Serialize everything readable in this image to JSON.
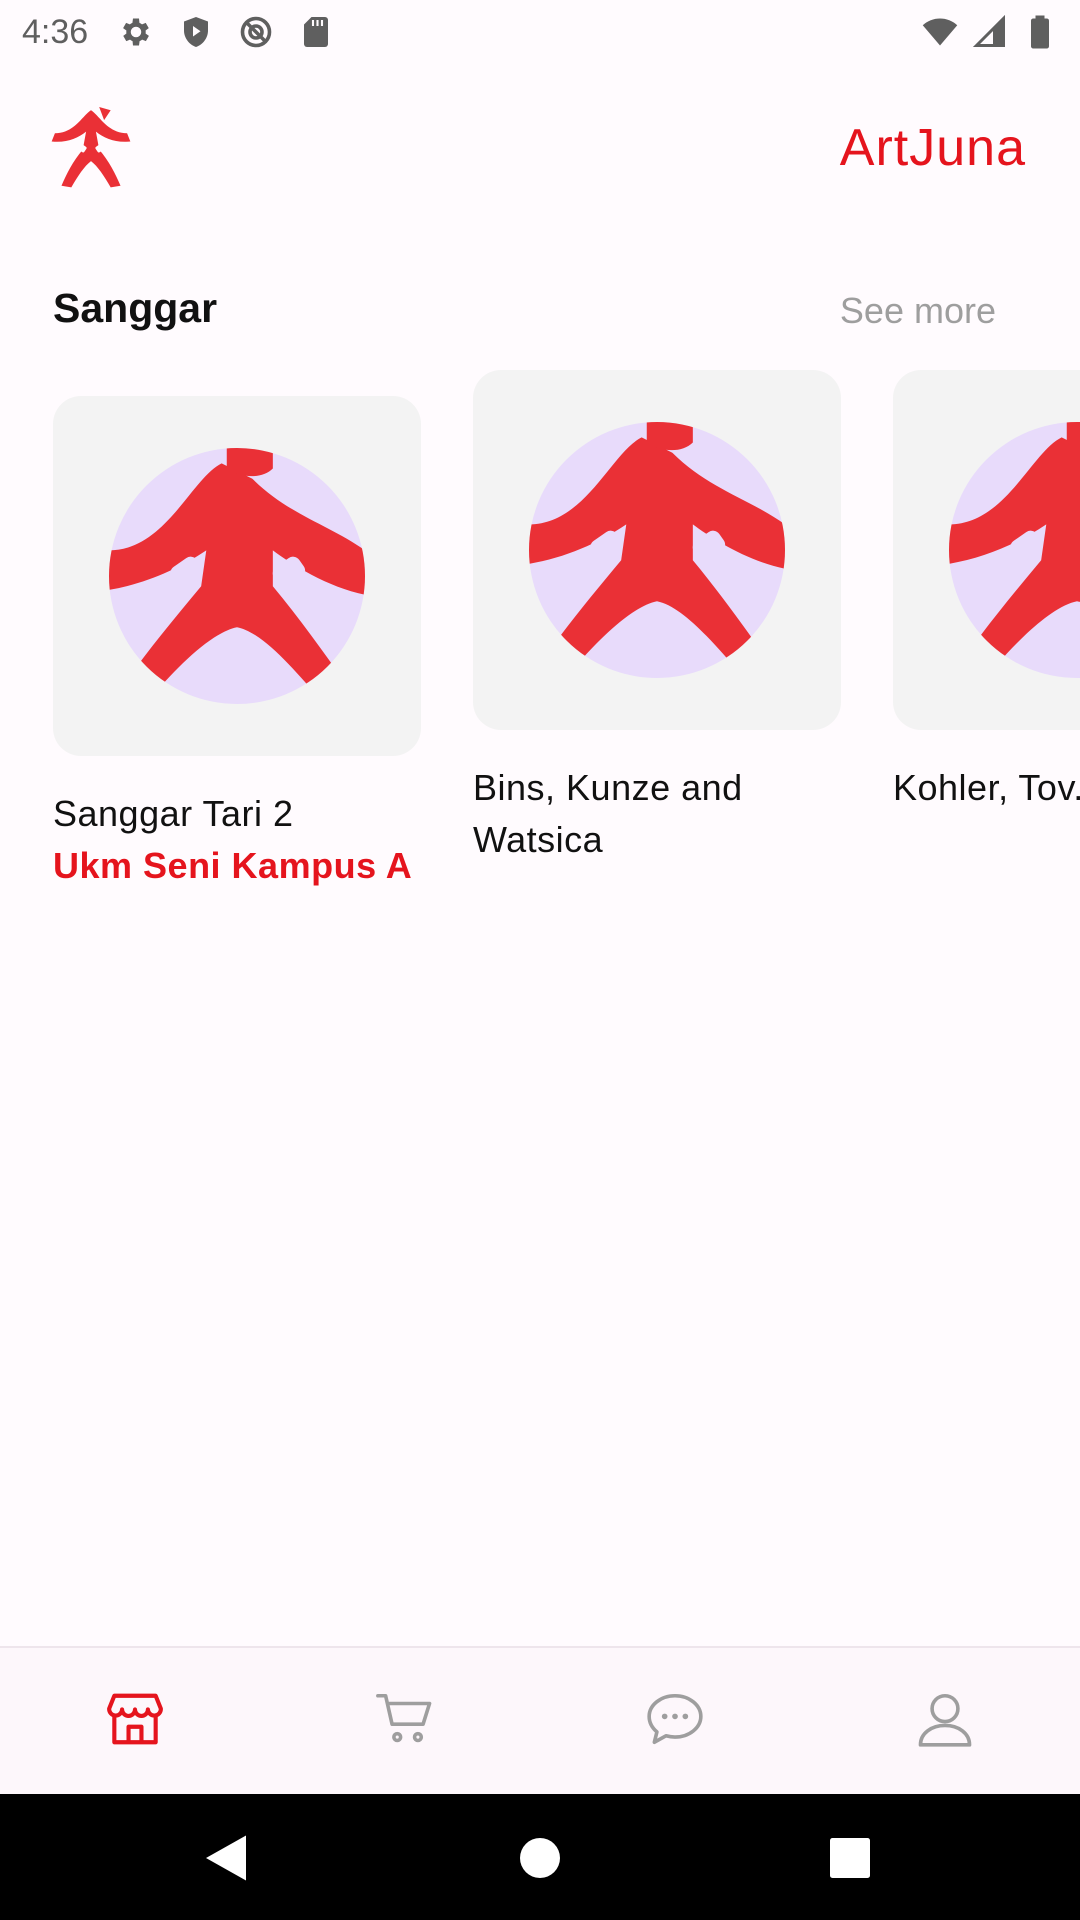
{
  "status_bar": {
    "time": "4:36",
    "left_icons": [
      "settings-icon",
      "shield-icon",
      "no-tracking-icon",
      "sd-card-icon"
    ],
    "right_icons": [
      "wifi-icon",
      "signal-icon",
      "battery-icon"
    ]
  },
  "app_bar": {
    "title": "ArtJuna",
    "logo_icon": "artjuna-logo"
  },
  "section": {
    "title": "Sanggar",
    "see_more": "See more"
  },
  "cards": [
    {
      "name": "Sanggar Tari 2",
      "org": "Ukm Seni Kampus A"
    },
    {
      "name": "Bins, Kunze and Watsica",
      "org": ""
    },
    {
      "name": "Kohler, Tov... Koch",
      "org": ""
    }
  ],
  "bottom_nav": {
    "items": [
      {
        "icon": "store-icon",
        "active": true
      },
      {
        "icon": "cart-icon",
        "active": false
      },
      {
        "icon": "chat-icon",
        "active": false
      },
      {
        "icon": "profile-icon",
        "active": false
      }
    ]
  },
  "colors": {
    "accent": "#e5141d",
    "logo_red": "#ea3036",
    "avatar_bg": "#e8dbfb",
    "card_bg": "#f3f3f3",
    "muted": "#9e9e9e",
    "nav_bg": "#fdf7fb"
  }
}
